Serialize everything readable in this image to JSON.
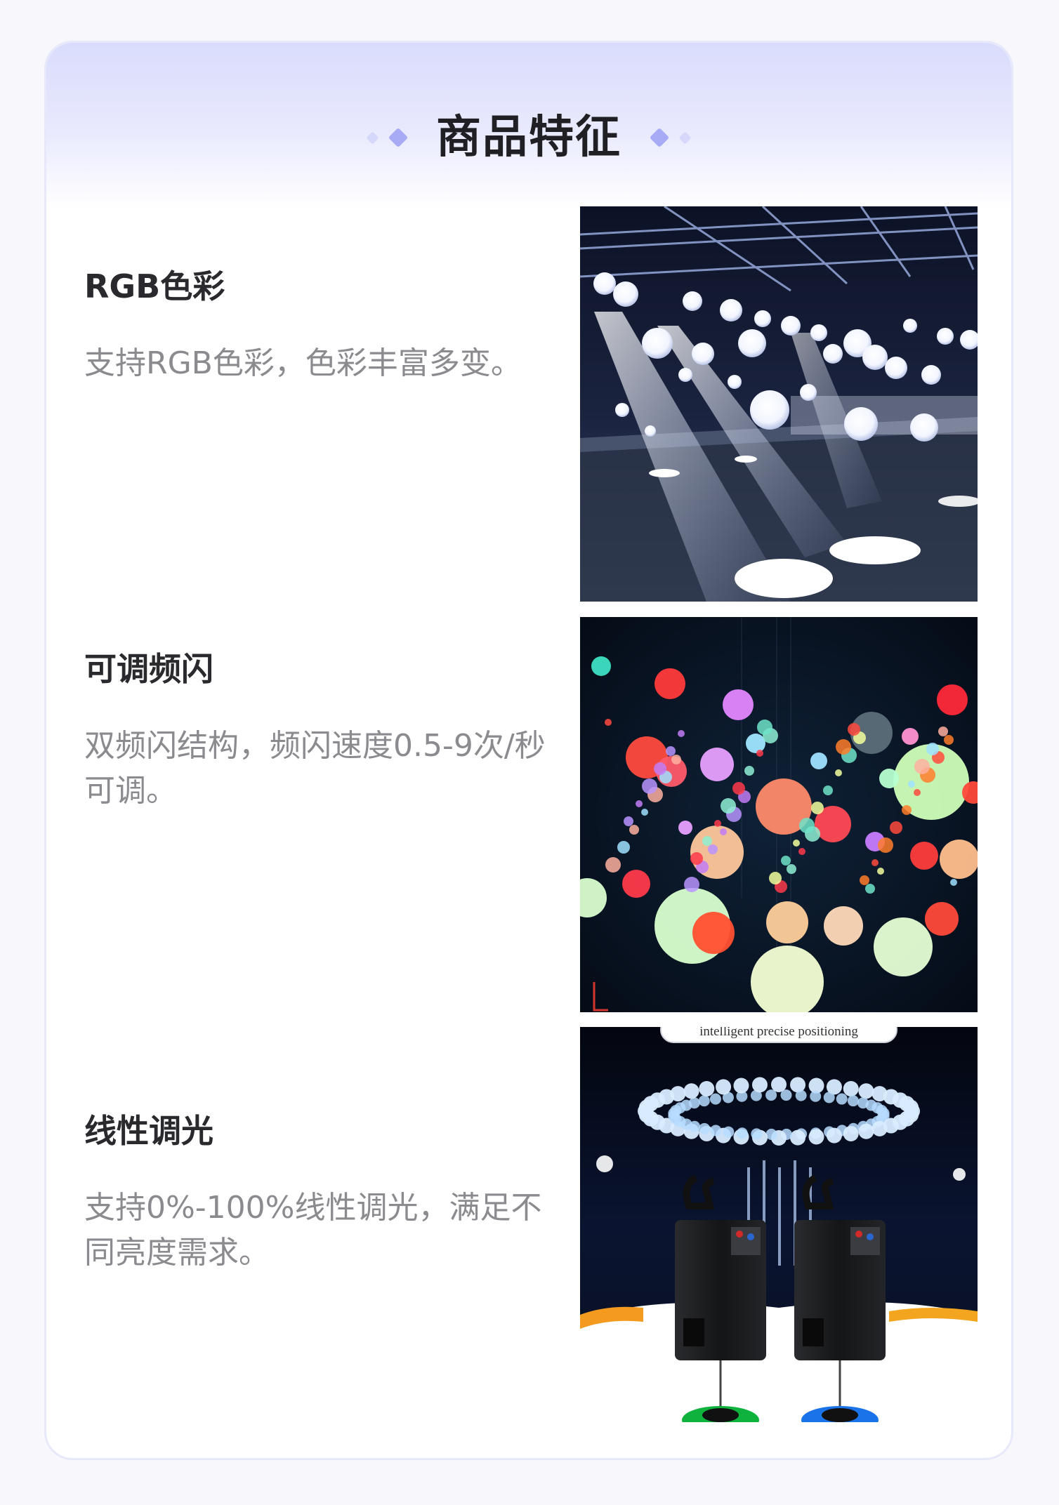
{
  "section": {
    "title": "商品特征"
  },
  "features": [
    {
      "title": "RGB色彩",
      "description": "支持RGB色彩，色彩丰富多变。",
      "image": "dance-hall-white-kinetic-balls-photo"
    },
    {
      "title": "可调频闪",
      "description": "双频闪结构，频闪速度0.5-9次/秒可调。",
      "image": "colorful-hanging-balls-photo"
    },
    {
      "title": "线性调光",
      "description": "支持0%-100%线性调光，满足不同亮度需求。",
      "image": "winch-units-ring-of-balls-photo",
      "image_caption": "intelligent precise positioning"
    }
  ],
  "colors": {
    "header_top": "#d9dcfc",
    "diamond_light": "#d6d8fb",
    "diamond_accent": "#a7abf5",
    "title_text": "#1f1f24",
    "desc_text": "#8a8a8f"
  }
}
